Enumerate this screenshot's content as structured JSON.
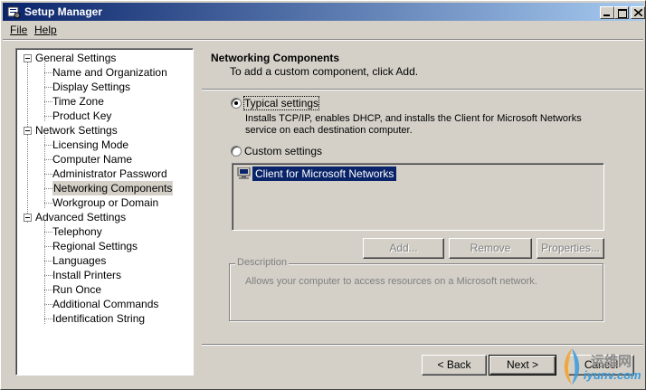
{
  "window": {
    "title": "Setup Manager"
  },
  "menu": {
    "file": "File",
    "help": "Help"
  },
  "tree": {
    "items": [
      {
        "label": "General Settings",
        "level": 0
      },
      {
        "label": "Name and Organization",
        "level": 1
      },
      {
        "label": "Display Settings",
        "level": 1
      },
      {
        "label": "Time Zone",
        "level": 1
      },
      {
        "label": "Product Key",
        "level": 1
      },
      {
        "label": "Network Settings",
        "level": 0
      },
      {
        "label": "Licensing Mode",
        "level": 1
      },
      {
        "label": "Computer Name",
        "level": 1
      },
      {
        "label": "Administrator Password",
        "level": 1
      },
      {
        "label": "Networking Components",
        "level": 1,
        "selected": true
      },
      {
        "label": "Workgroup or Domain",
        "level": 1
      },
      {
        "label": "Advanced Settings",
        "level": 0
      },
      {
        "label": "Telephony",
        "level": 1
      },
      {
        "label": "Regional Settings",
        "level": 1
      },
      {
        "label": "Languages",
        "level": 1
      },
      {
        "label": "Install Printers",
        "level": 1
      },
      {
        "label": "Run Once",
        "level": 1
      },
      {
        "label": "Additional Commands",
        "level": 1
      },
      {
        "label": "Identification String",
        "level": 1
      }
    ]
  },
  "header": {
    "title": "Networking Components",
    "subtitle": "To add a custom component, click Add."
  },
  "options": {
    "typical": {
      "label": "Typical settings",
      "checked": true,
      "description": "Installs TCP/IP, enables DHCP, and installs the Client for Microsoft Networks service on each destination computer."
    },
    "custom": {
      "label": "Custom settings",
      "checked": false
    }
  },
  "components": {
    "items": [
      {
        "label": "Client for Microsoft Networks",
        "icon": "network-client-icon"
      }
    ]
  },
  "actions": {
    "add": "Add...",
    "remove": "Remove",
    "properties": "Properties..."
  },
  "description_group": {
    "label": "Description",
    "text": "Allows your computer to access resources on a Microsoft network."
  },
  "wizard": {
    "back": "< Back",
    "next": "Next >",
    "cancel": "Cancel"
  },
  "watermark": {
    "cn": "运维网",
    "en": "iyunv.com"
  },
  "colors": {
    "titlebar_start": "#0a246a",
    "titlebar_end": "#a6caf0",
    "selection": "#0a246a",
    "face": "#d4d0c8"
  }
}
